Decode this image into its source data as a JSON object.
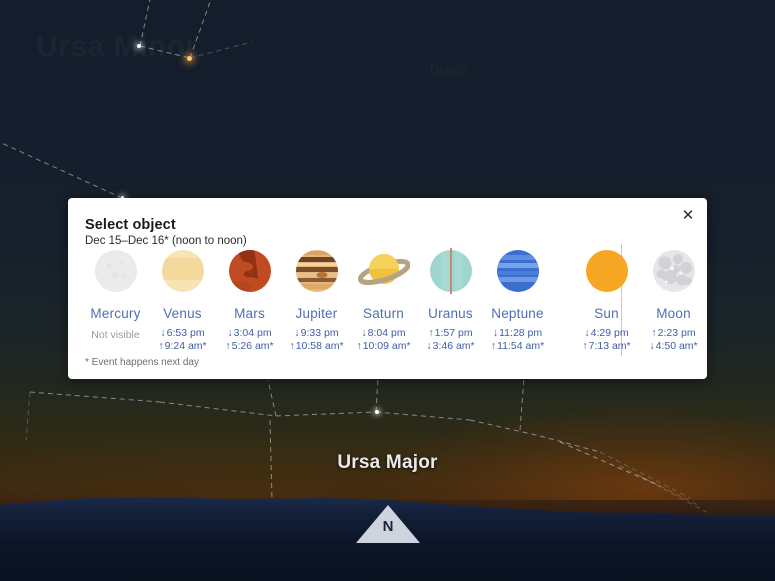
{
  "sky": {
    "constellation_label": "Ursa Major",
    "faint_labels": [
      "Ursa Minor",
      "Draco"
    ],
    "compass": {
      "direction_label": "N"
    }
  },
  "dialog": {
    "title": "Select object",
    "subtitle": "Dec 15–Dec 16* (noon to noon)",
    "footnote": "* Event happens next day",
    "close_label": "✕",
    "objects": [
      {
        "name": "Mercury",
        "icon": "mercury-icon",
        "status": "Not visible",
        "times": []
      },
      {
        "name": "Venus",
        "icon": "venus-icon",
        "status": null,
        "times": [
          {
            "arrow": "↓",
            "time": "6:53 pm"
          },
          {
            "arrow": "↑",
            "time": "9:24 am*"
          }
        ]
      },
      {
        "name": "Mars",
        "icon": "mars-icon",
        "status": null,
        "times": [
          {
            "arrow": "↓",
            "time": "3:04 pm"
          },
          {
            "arrow": "↑",
            "time": "5:26 am*"
          }
        ]
      },
      {
        "name": "Jupiter",
        "icon": "jupiter-icon",
        "status": null,
        "times": [
          {
            "arrow": "↓",
            "time": "9:33 pm"
          },
          {
            "arrow": "↑",
            "time": "10:58 am*"
          }
        ]
      },
      {
        "name": "Saturn",
        "icon": "saturn-icon",
        "status": null,
        "times": [
          {
            "arrow": "↓",
            "time": "8:04 pm"
          },
          {
            "arrow": "↑",
            "time": "10:09 am*"
          }
        ]
      },
      {
        "name": "Uranus",
        "icon": "uranus-icon",
        "status": null,
        "times": [
          {
            "arrow": "↑",
            "time": "1:57 pm"
          },
          {
            "arrow": "↓",
            "time": "3:46 am*"
          }
        ]
      },
      {
        "name": "Neptune",
        "icon": "neptune-icon",
        "status": null,
        "times": [
          {
            "arrow": "↓",
            "time": "11:28 pm"
          },
          {
            "arrow": "↑",
            "time": "11:54 am*"
          }
        ]
      },
      {
        "name": "Sun",
        "icon": "sun-icon",
        "status": null,
        "times": [
          {
            "arrow": "↓",
            "time": "4:29 pm"
          },
          {
            "arrow": "↑",
            "time": "7:13 am*"
          }
        ]
      },
      {
        "name": "Moon",
        "icon": "moon-icon",
        "status": null,
        "times": [
          {
            "arrow": "↑",
            "time": "2:23 pm"
          },
          {
            "arrow": "↓",
            "time": "4:50 am*"
          }
        ]
      }
    ]
  },
  "colors": {
    "link_blue": "#4f6fb5",
    "time_blue": "#3f5ca8",
    "muted_gray": "#9b9b9b",
    "dialog_bg": "#ffffff",
    "sky_top": "#141d2b",
    "sunset_orange": "#3d2810"
  }
}
